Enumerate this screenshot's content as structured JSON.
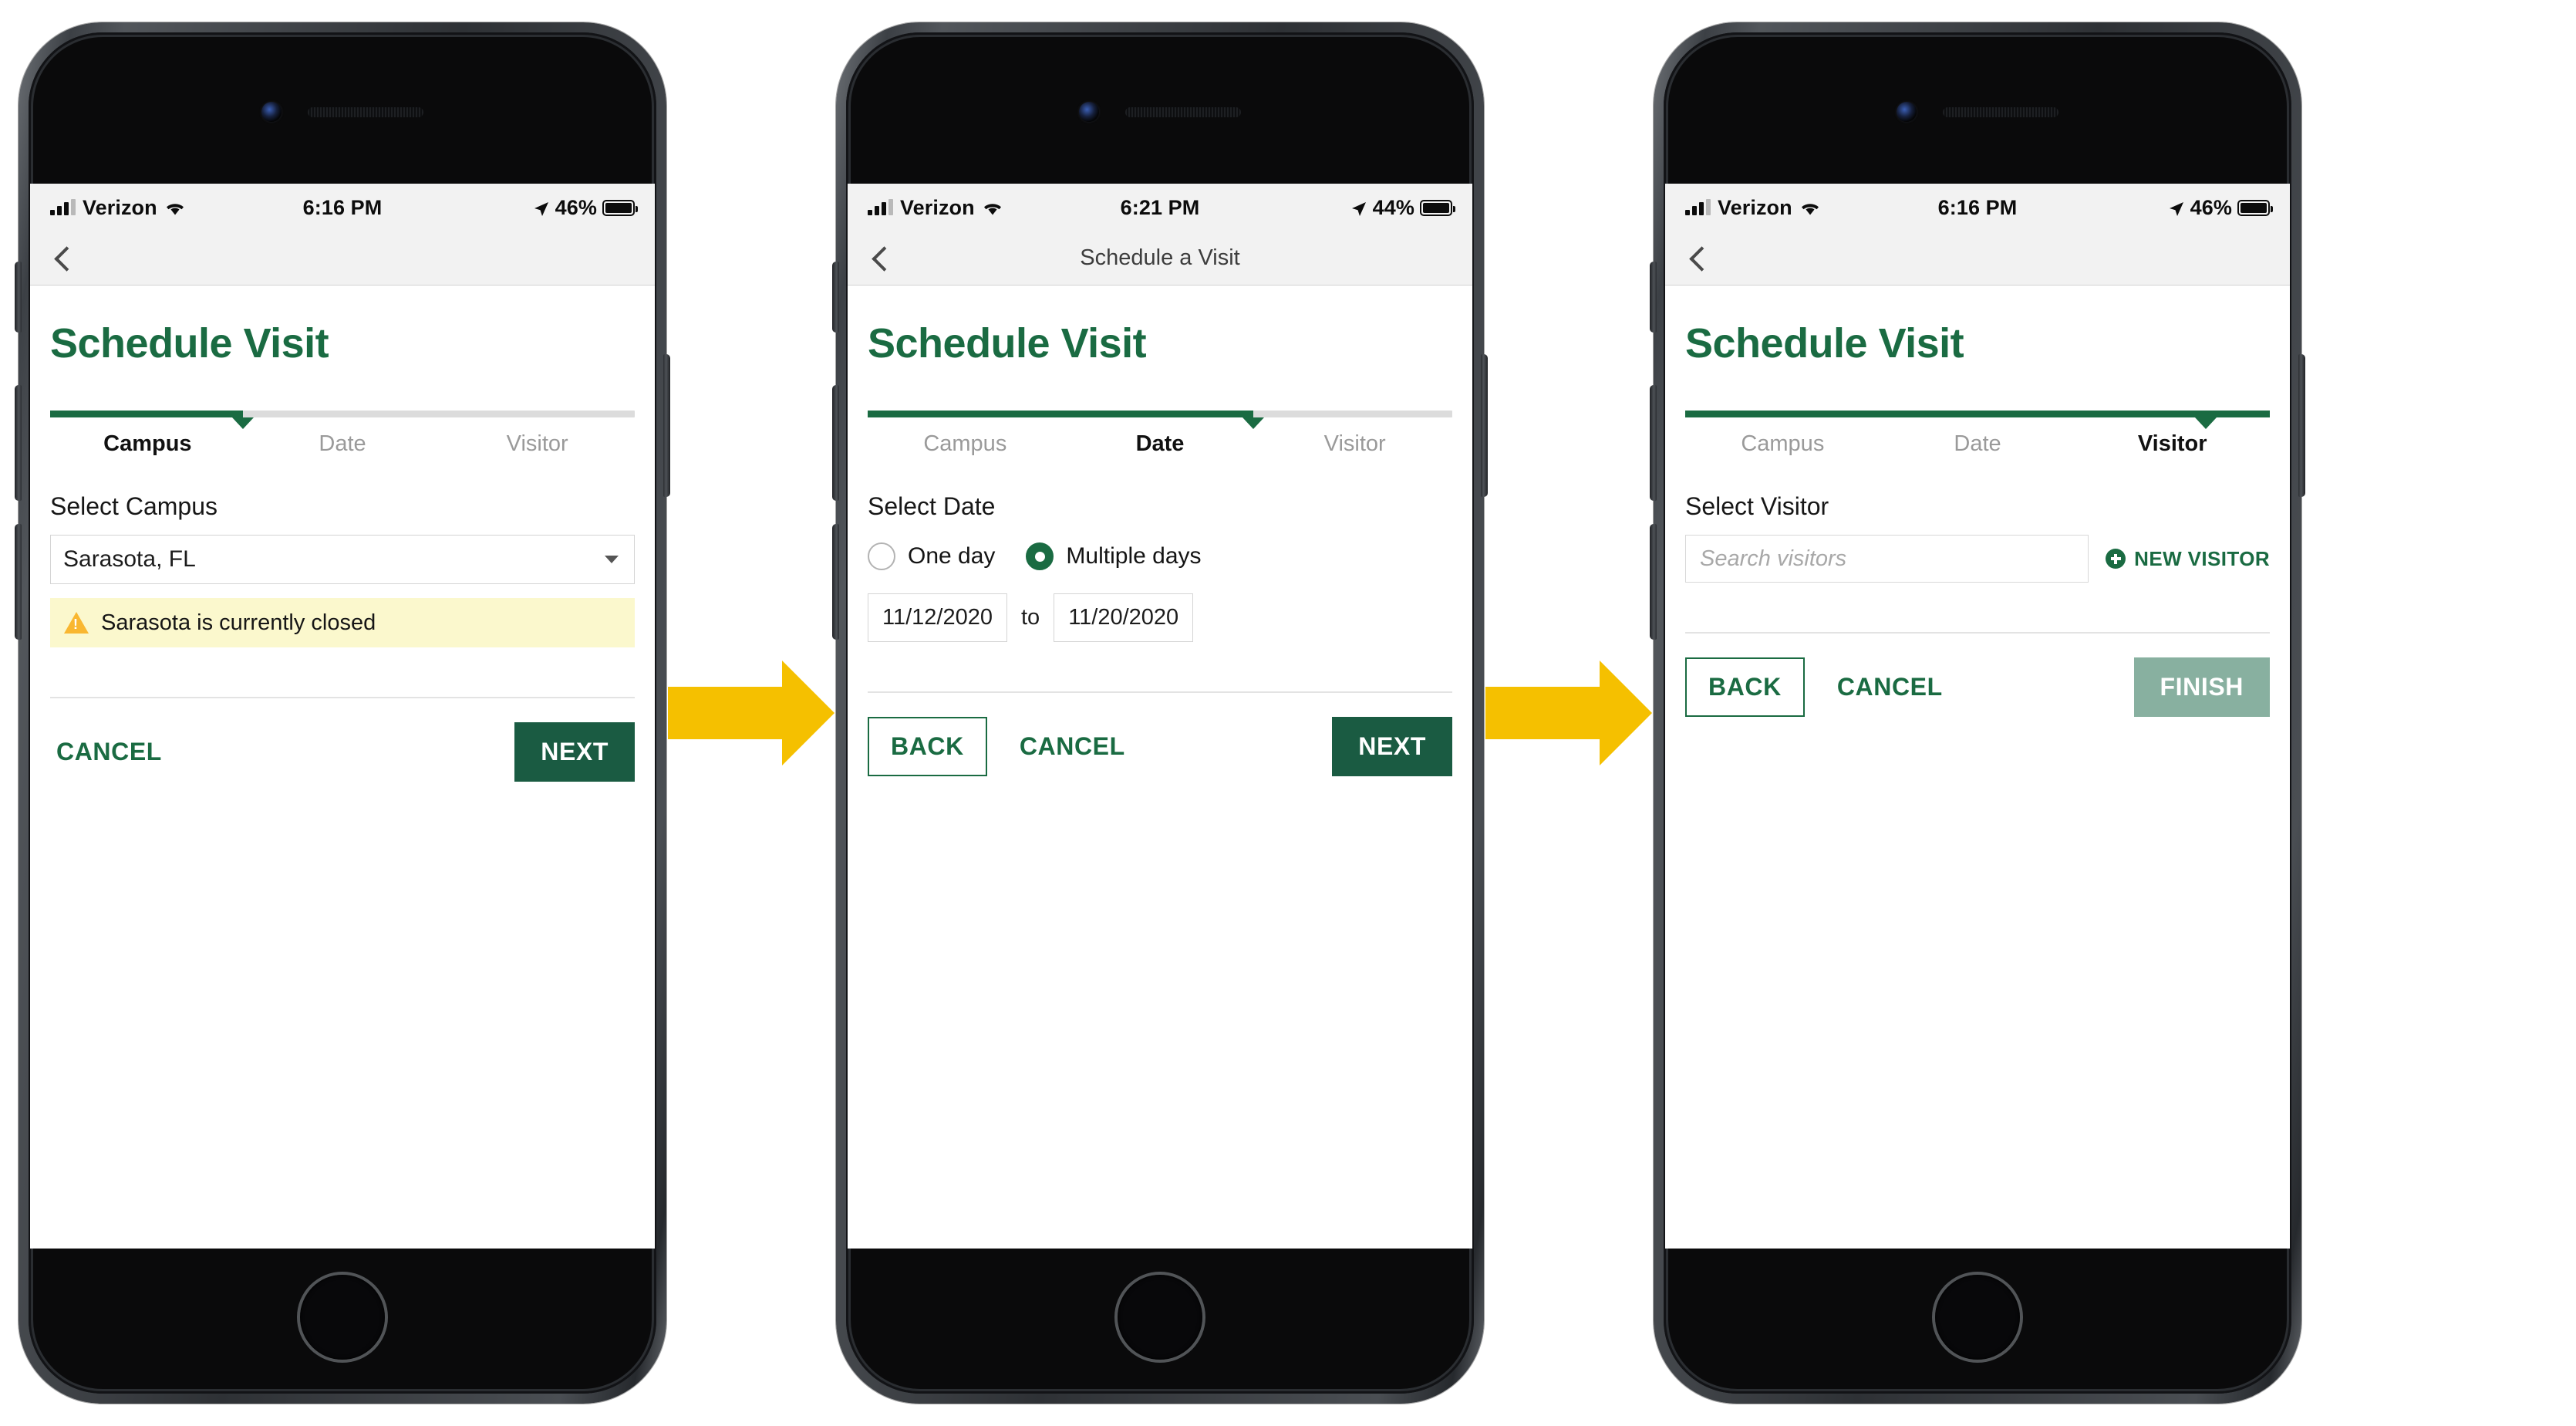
{
  "theme": {
    "brand_green": "#1a6b42",
    "primary_button": "#1a5b42",
    "disabled_button": "#88b0a0",
    "arrow_gold": "#f5c000",
    "warning_bg": "#fbf8cd",
    "warning_icon": "#f9b731"
  },
  "phones": [
    {
      "status_bar": {
        "carrier": "Verizon",
        "time": "6:16 PM",
        "battery_percent": "46%",
        "signal_icon": "signal-bars-icon",
        "wifi_icon": "wifi-icon",
        "location_icon": "location-arrow-icon",
        "battery_icon": "battery-icon"
      },
      "nav": {
        "back_icon": "back-chevron-icon",
        "title": ""
      },
      "page_title": "Schedule Visit",
      "stepper": {
        "steps": [
          "Campus",
          "Date",
          "Visitor"
        ],
        "active_index": 0,
        "fill_percent": 33
      },
      "form": {
        "label": "Select Campus",
        "select_value": "Sarasota, FL",
        "dropdown_icon": "chevron-down-icon",
        "alert": {
          "icon": "warning-triangle-icon",
          "text": "Sarasota is currently closed"
        }
      },
      "actions": {
        "cancel": "CANCEL",
        "primary": "NEXT"
      }
    },
    {
      "status_bar": {
        "carrier": "Verizon",
        "time": "6:21 PM",
        "battery_percent": "44%",
        "signal_icon": "signal-bars-icon",
        "wifi_icon": "wifi-icon",
        "location_icon": "location-arrow-icon",
        "battery_icon": "battery-icon"
      },
      "nav": {
        "back_icon": "back-chevron-icon",
        "title": "Schedule a Visit"
      },
      "page_title": "Schedule Visit",
      "stepper": {
        "steps": [
          "Campus",
          "Date",
          "Visitor"
        ],
        "active_index": 1,
        "fill_percent": 66
      },
      "form": {
        "label": "Select Date",
        "radios": [
          {
            "label": "One day",
            "checked": false
          },
          {
            "label": "Multiple days",
            "checked": true
          }
        ],
        "date_from": "11/12/2020",
        "date_separator": "to",
        "date_to": "11/20/2020"
      },
      "actions": {
        "back": "BACK",
        "cancel": "CANCEL",
        "primary": "NEXT"
      }
    },
    {
      "status_bar": {
        "carrier": "Verizon",
        "time": "6:16 PM",
        "battery_percent": "46%",
        "signal_icon": "signal-bars-icon",
        "wifi_icon": "wifi-icon",
        "location_icon": "location-arrow-icon",
        "battery_icon": "battery-icon"
      },
      "nav": {
        "back_icon": "back-chevron-icon",
        "title": ""
      },
      "page_title": "Schedule Visit",
      "stepper": {
        "steps": [
          "Campus",
          "Date",
          "Visitor"
        ],
        "active_index": 2,
        "fill_percent": 100
      },
      "form": {
        "label": "Select Visitor",
        "search_placeholder": "Search visitors",
        "new_visitor_label": "NEW VISITOR",
        "new_visitor_icon": "plus-circle-icon"
      },
      "actions": {
        "back": "BACK",
        "cancel": "CANCEL",
        "primary": "FINISH",
        "primary_disabled": true
      }
    }
  ],
  "connectors": [
    {
      "icon": "arrow-right-icon"
    },
    {
      "icon": "arrow-right-icon"
    }
  ]
}
